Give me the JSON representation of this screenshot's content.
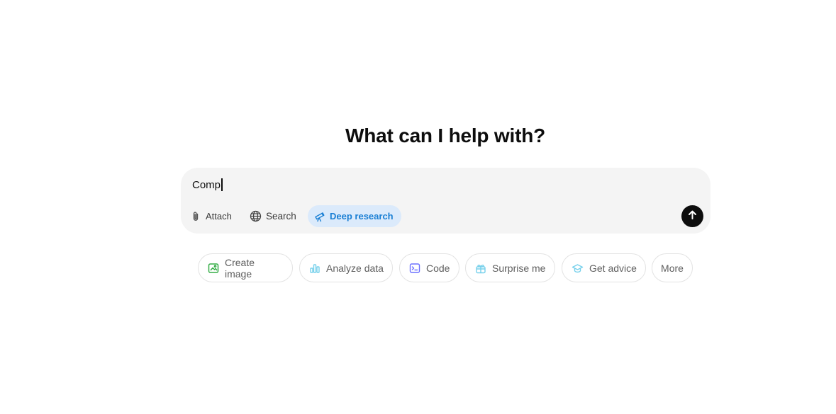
{
  "heading": "What can I help with?",
  "composer": {
    "input_value": "Comp",
    "tools": [
      {
        "label": "Attach",
        "icon": "paperclip-icon"
      },
      {
        "label": "Search",
        "icon": "globe-icon"
      },
      {
        "label": "Deep research",
        "icon": "telescope-icon",
        "active": true
      }
    ],
    "send_icon": "arrow-up-icon"
  },
  "suggestions": [
    {
      "label": "Create image",
      "icon": "image-icon",
      "color": "#35ae47"
    },
    {
      "label": "Analyze data",
      "icon": "bar-chart-icon",
      "color": "#76d0eb"
    },
    {
      "label": "Code",
      "icon": "terminal-icon",
      "color": "#6c71ff"
    },
    {
      "label": "Surprise me",
      "icon": "gift-icon",
      "color": "#76d0eb"
    },
    {
      "label": "Get advice",
      "icon": "graduation-cap-icon",
      "color": "#76d0eb"
    },
    {
      "label": "More"
    }
  ],
  "colors": {
    "composer_bg": "#f4f4f4",
    "active_tool_bg": "#dbeafb",
    "active_tool_text": "#1a7fd4",
    "send_button": "#0d0d0d"
  }
}
